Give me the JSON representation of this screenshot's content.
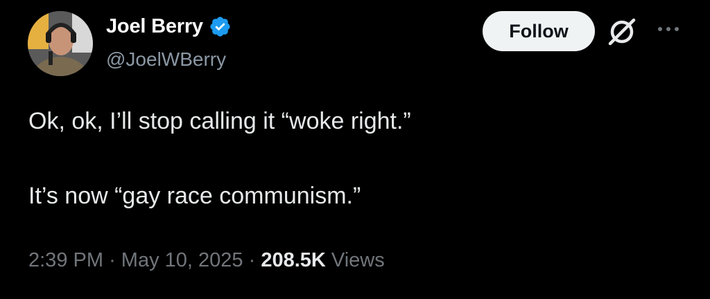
{
  "author": {
    "display_name": "Joel Berry",
    "handle": "@JoelWBerry",
    "verified": true,
    "avatar_icon": "user-avatar"
  },
  "actions": {
    "follow_label": "Follow",
    "grok_icon": "grok-icon",
    "more_icon": "more-options-icon"
  },
  "tweet": {
    "lines": [
      "Ok, ok, I’ll stop calling it “woke right.”",
      "It’s now “gay race communism.”"
    ]
  },
  "meta": {
    "time": "2:39 PM",
    "separator": "·",
    "date": "May 10, 2025",
    "views_count": "208.5K",
    "views_label": "Views"
  },
  "colors": {
    "background": "#000000",
    "text_primary": "#e7e9ea",
    "text_secondary": "#71767b",
    "verified_blue": "#1d9bf0",
    "follow_bg": "#eff3f4"
  }
}
